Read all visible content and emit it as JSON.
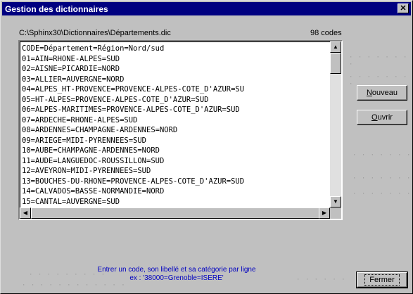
{
  "window": {
    "title": "Gestion des dictionnaires",
    "close_glyph": "✕"
  },
  "header": {
    "path": "C:\\Sphinx30\\Dictionnaires\\Départements.dic",
    "count": "98 codes"
  },
  "editor": {
    "lines": [
      "CODE=Département=Région=Nord/sud",
      "01=AIN=RHONE-ALPES=SUD",
      "02=AISNE=PICARDIE=NORD",
      "03=ALLIER=AUVERGNE=NORD",
      "04=ALPES_HT-PROVENCE=PROVENCE-ALPES-COTE_D'AZUR=SU",
      "05=HT-ALPES=PROVENCE-ALPES-COTE_D'AZUR=SUD",
      "06=ALPES-MARITIMES=PROVENCE-ALPES-COTE_D'AZUR=SUD",
      "07=ARDECHE=RHONE-ALPES=SUD",
      "08=ARDENNES=CHAMPAGNE-ARDENNES=NORD",
      "09=ARIEGE=MIDI-PYRENNEES=SUD",
      "10=AUBE=CHAMPAGNE-ARDENNES=NORD",
      "11=AUDE=LANGUEDOC-ROUSSILLON=SUD",
      "12=AVEYRON=MIDI-PYRENNEES=SUD",
      "13=BOUCHES-DU-RHONE=PROVENCE-ALPES-COTE_D'AZUR=SUD",
      "14=CALVADOS=BASSE-NORMANDIE=NORD",
      "15=CANTAL=AUVERGNE=SUD"
    ]
  },
  "buttons": {
    "nouveau_first": "N",
    "nouveau_rest": "ouveau",
    "ouvrir_first": "O",
    "ouvrir_rest": "uvrir",
    "fermer": "Fermer"
  },
  "hint": {
    "line1": "Entrer un code, son libellé et sa catégorie par ligne",
    "line2": "ex : '38000=Grenoble=ISERE'"
  },
  "colors": {
    "titlebar": "#000080",
    "hint_text": "#0000c0",
    "face": "#c0c0c0"
  }
}
